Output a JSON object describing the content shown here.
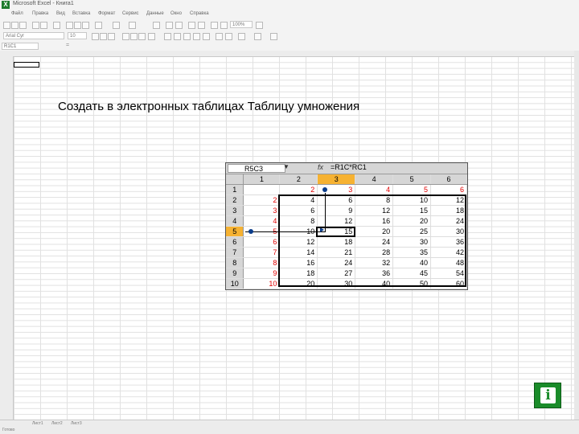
{
  "window": {
    "title": "Microsoft Excel - Книга1"
  },
  "menu": {
    "items": [
      "Файл",
      "Правка",
      "Вид",
      "Вставка",
      "Формат",
      "Сервис",
      "Данные",
      "Окно",
      "Справка"
    ]
  },
  "toolbar": {
    "font_name": "Arial Cyr",
    "font_size": "10",
    "zoom": "100%"
  },
  "formula_bar": {
    "name_box": "R1C1"
  },
  "sheet": {
    "tabs": [
      "Лист1",
      "Лист2",
      "Лист3"
    ],
    "status": "Готово"
  },
  "heading": "Создать в электронных таблицах Таблицу умножения",
  "inset": {
    "name_box": "R5C3",
    "fx": "fx",
    "formula": "=R1C*RC1",
    "col_headers": [
      "1",
      "2",
      "3",
      "4",
      "5",
      "6"
    ],
    "rows": [
      {
        "h": "1",
        "cells": [
          "",
          "2",
          "3",
          "4",
          "5",
          "6"
        ]
      },
      {
        "h": "2",
        "cells": [
          "2",
          "4",
          "6",
          "8",
          "10",
          "12"
        ]
      },
      {
        "h": "3",
        "cells": [
          "3",
          "6",
          "9",
          "12",
          "15",
          "18"
        ]
      },
      {
        "h": "4",
        "cells": [
          "4",
          "8",
          "12",
          "16",
          "20",
          "24"
        ]
      },
      {
        "h": "5",
        "cells": [
          "5",
          "10",
          "15",
          "20",
          "25",
          "30"
        ]
      },
      {
        "h": "6",
        "cells": [
          "6",
          "12",
          "18",
          "24",
          "30",
          "36"
        ]
      },
      {
        "h": "7",
        "cells": [
          "7",
          "14",
          "21",
          "28",
          "35",
          "42"
        ]
      },
      {
        "h": "8",
        "cells": [
          "8",
          "16",
          "24",
          "32",
          "40",
          "48"
        ]
      },
      {
        "h": "9",
        "cells": [
          "9",
          "18",
          "27",
          "36",
          "45",
          "54"
        ]
      },
      {
        "h": "10",
        "cells": [
          "10",
          "20",
          "30",
          "40",
          "50",
          "60"
        ]
      }
    ]
  },
  "info_button": {
    "label": "i"
  }
}
